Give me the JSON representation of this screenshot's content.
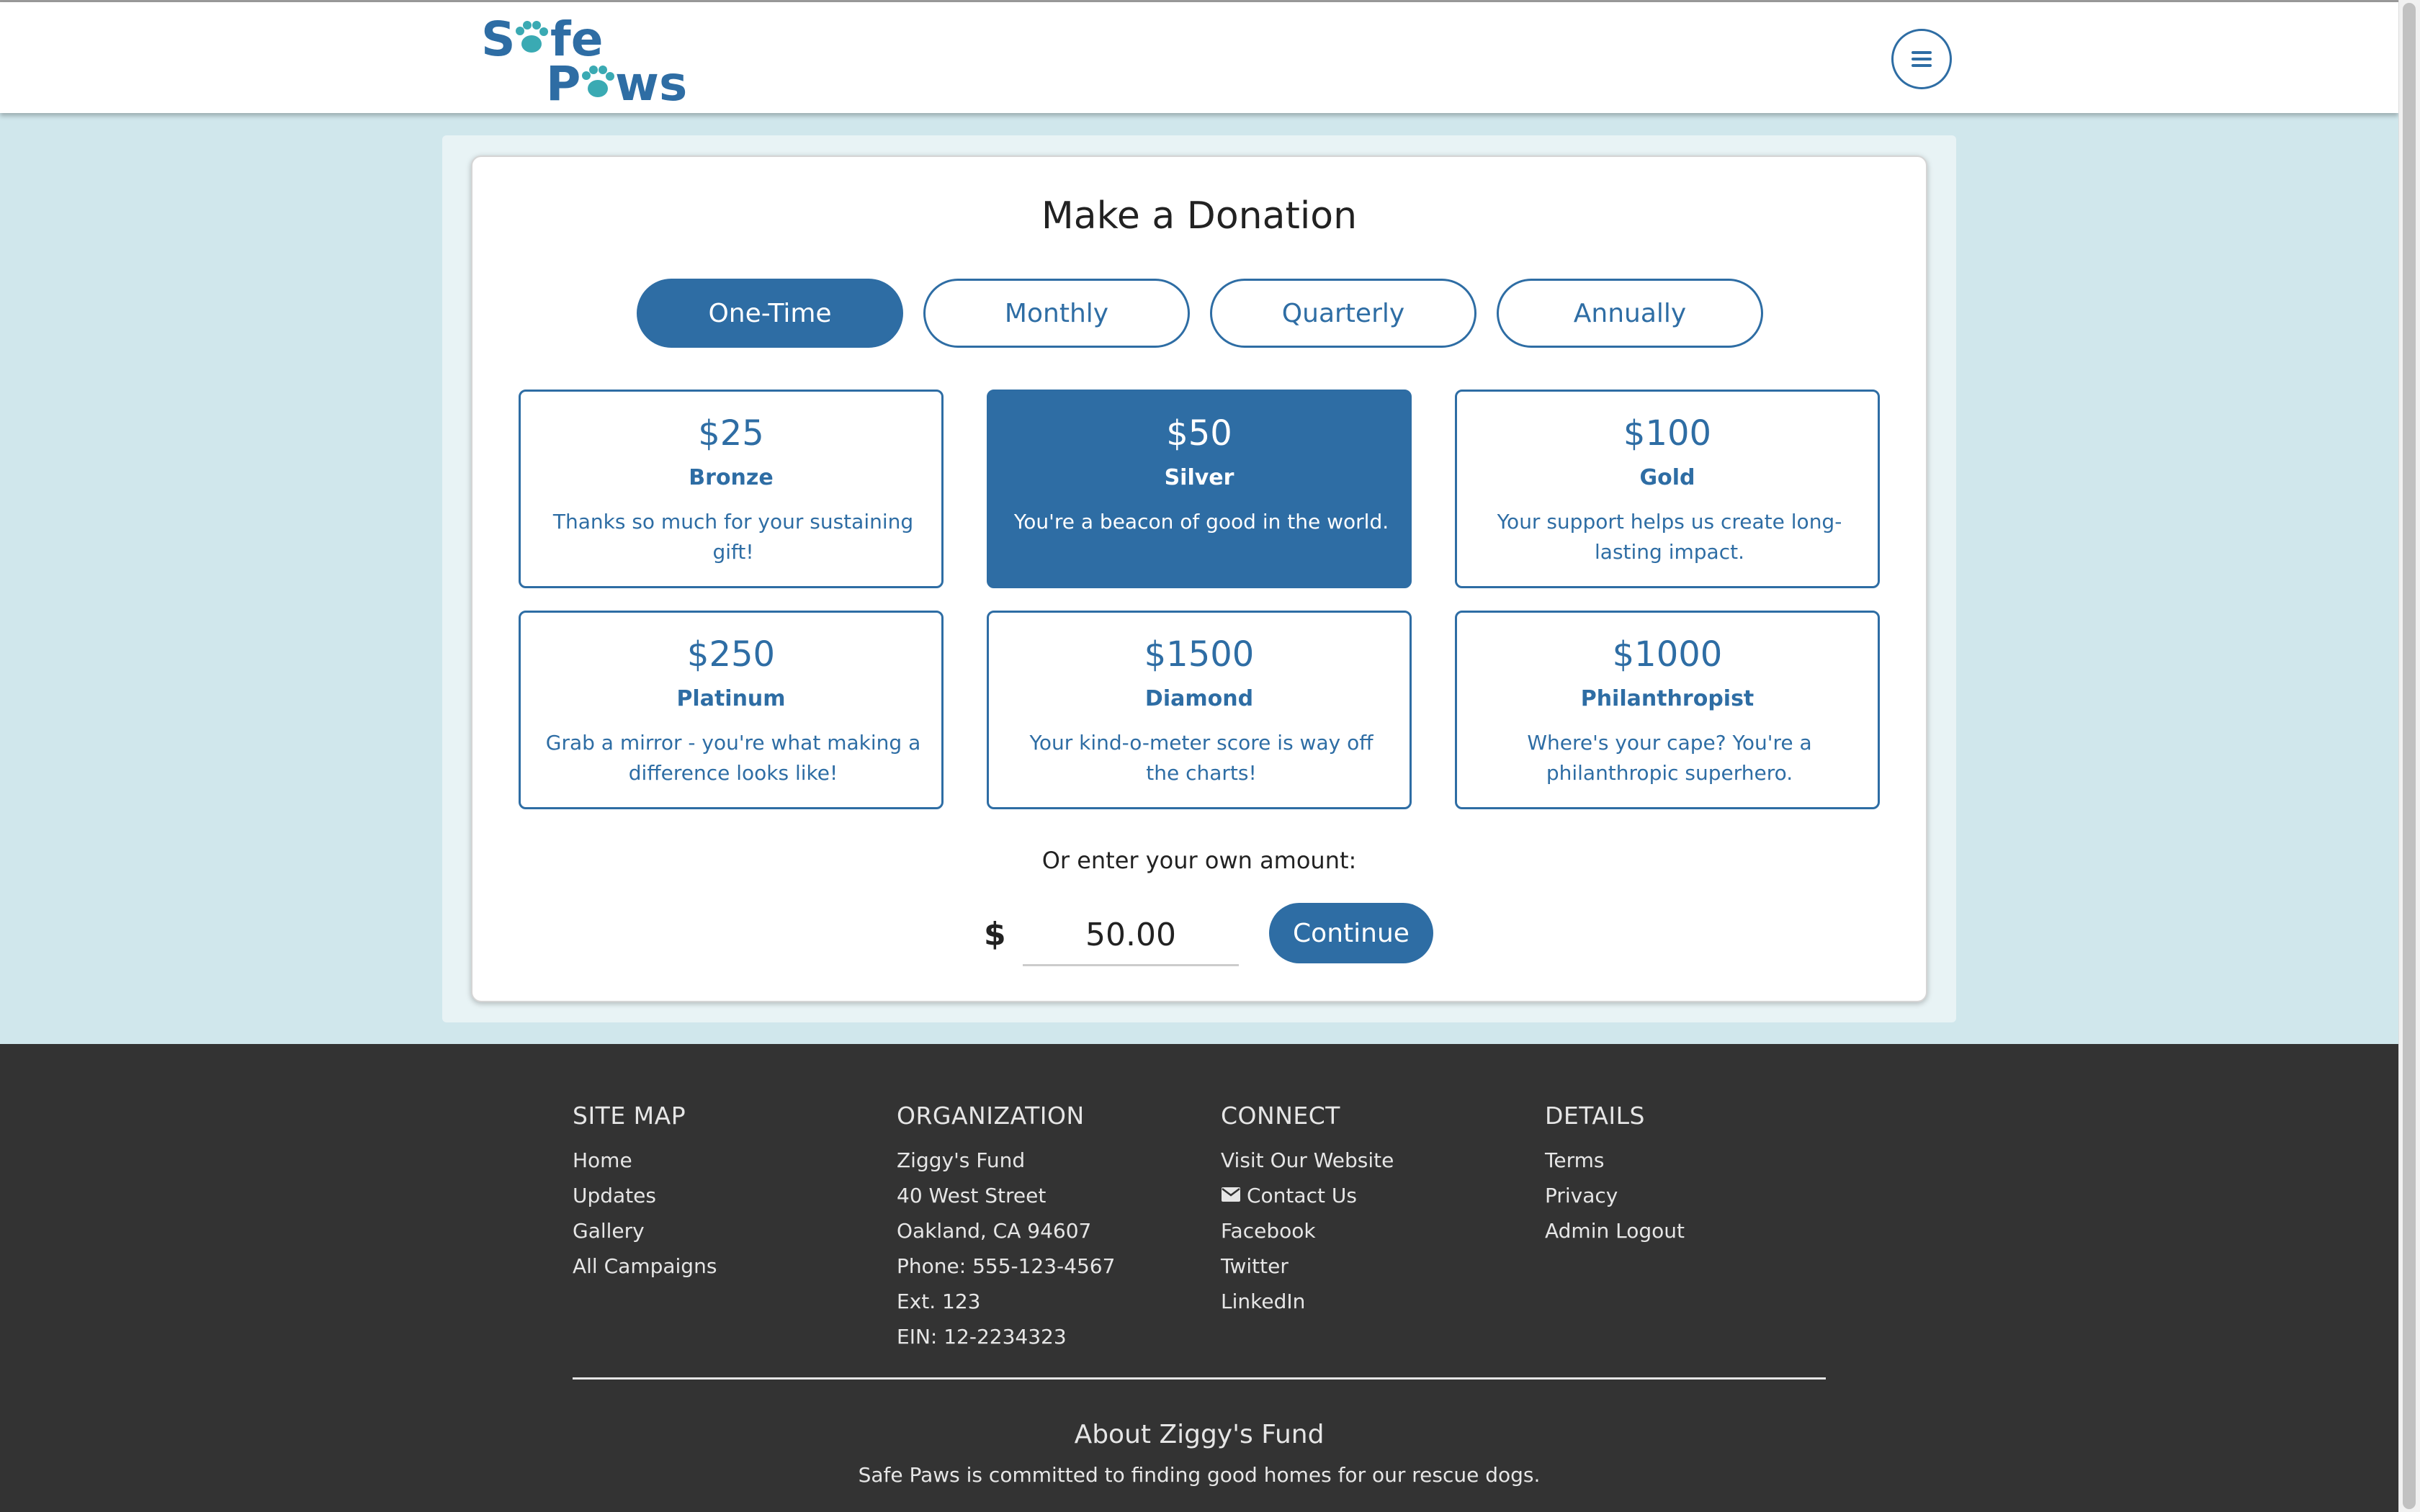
{
  "brand": {
    "logo_top": "Safe",
    "logo_bottom": "Paws",
    "primary_color": "#2e6da4",
    "accent_color": "#3aaab3"
  },
  "header": {
    "menu_icon": "hamburger-menu-icon"
  },
  "donation": {
    "title": "Make a Donation",
    "frequencies": [
      {
        "label": "One-Time",
        "active": true
      },
      {
        "label": "Monthly",
        "active": false
      },
      {
        "label": "Quarterly",
        "active": false
      },
      {
        "label": "Annually",
        "active": false
      }
    ],
    "tiers": [
      {
        "amount": "$25",
        "name": "Bronze",
        "message": "Thanks so much for your sustaining gift!",
        "selected": false
      },
      {
        "amount": "$50",
        "name": "Silver",
        "message": "You're a beacon of good in the world.",
        "selected": true
      },
      {
        "amount": "$100",
        "name": "Gold",
        "message": "Your support helps us create long-lasting impact.",
        "selected": false
      },
      {
        "amount": "$250",
        "name": "Platinum",
        "message": "Grab a mirror - you're what making a difference looks like!",
        "selected": false
      },
      {
        "amount": "$1500",
        "name": "Diamond",
        "message": "Your kind-o-meter score is way off the charts!",
        "selected": false
      },
      {
        "amount": "$1000",
        "name": "Philanthropist",
        "message": "Where's your cape? You're a philanthropic superhero.",
        "selected": false
      }
    ],
    "own_amount_label": "Or enter your own amount:",
    "currency_symbol": "$",
    "amount_value": "50.00",
    "continue_label": "Continue"
  },
  "footer": {
    "columns": [
      {
        "heading": "SITE MAP",
        "items": [
          "Home",
          "Updates",
          "Gallery",
          "All Campaigns"
        ]
      },
      {
        "heading": "ORGANIZATION",
        "items": [
          "Ziggy's Fund",
          "40 West Street",
          "Oakland, CA 94607",
          "Phone: 555-123-4567",
          "Ext. 123",
          "EIN: 12-2234323"
        ]
      },
      {
        "heading": "CONNECT",
        "items": [
          "Visit Our Website",
          "Contact Us",
          "Facebook",
          "Twitter",
          "LinkedIn"
        ]
      },
      {
        "heading": "DETAILS",
        "items": [
          "Terms",
          "Privacy",
          "Admin Logout"
        ]
      }
    ],
    "about_title": "About Ziggy's Fund",
    "about_text": "Safe Paws is committed to finding good homes for our rescue dogs."
  }
}
